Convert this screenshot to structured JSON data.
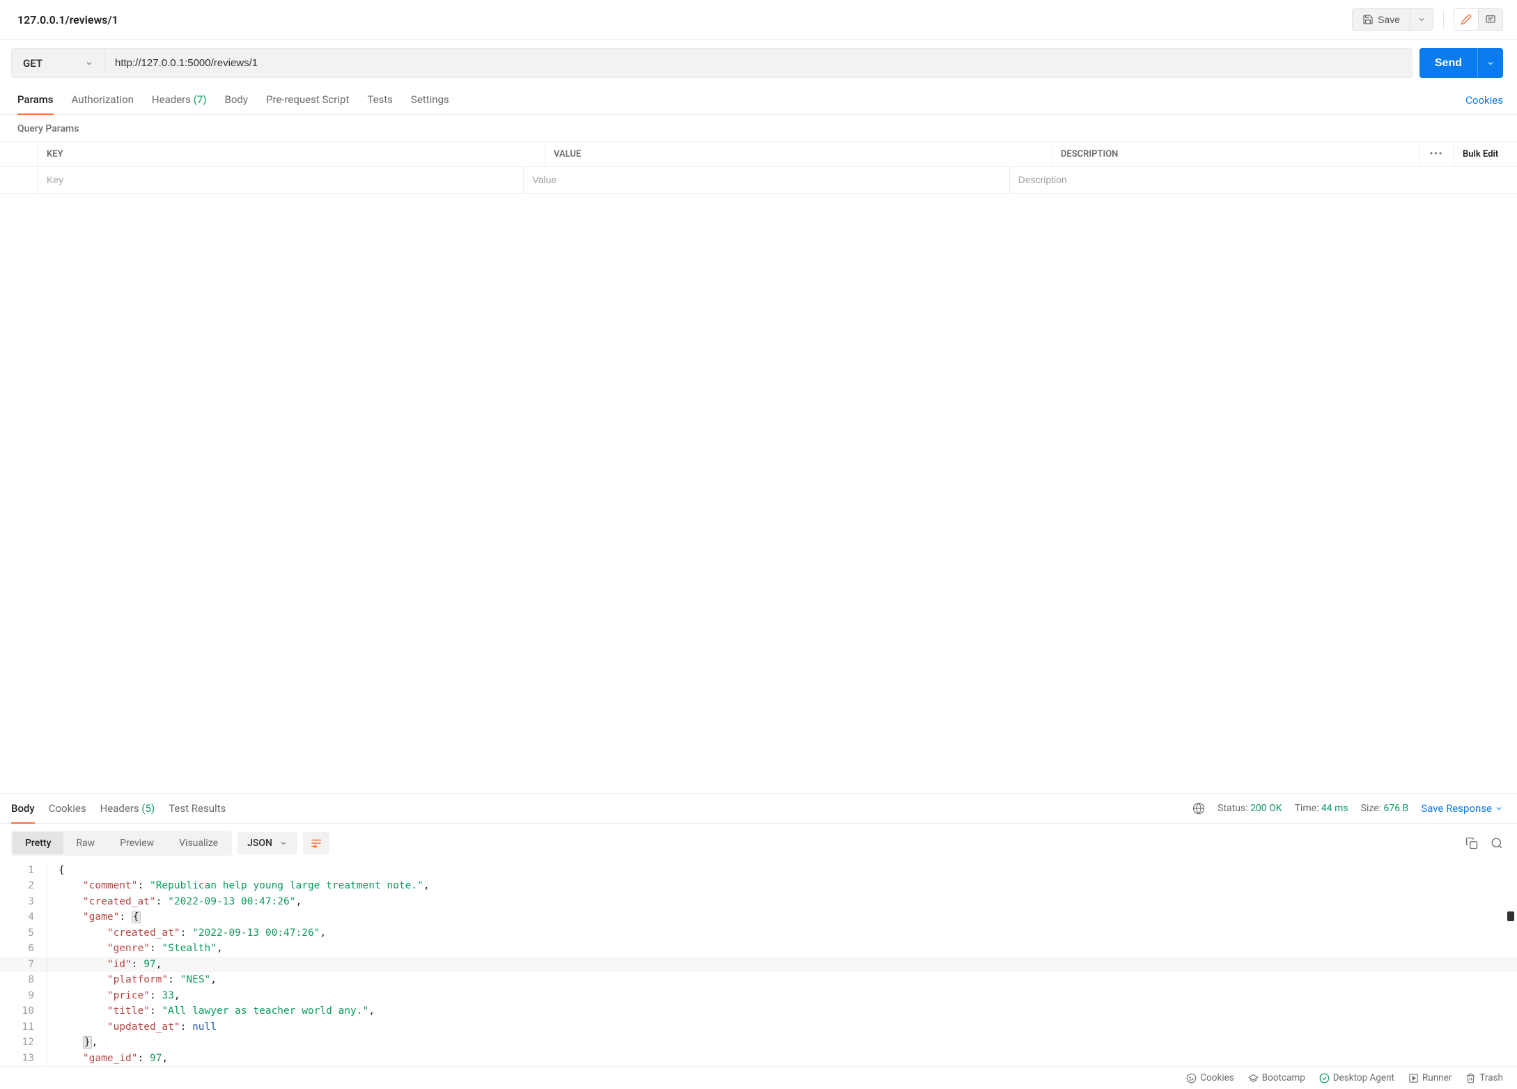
{
  "header": {
    "request_name": "127.0.0.1/reviews/1",
    "save_label": "Save"
  },
  "request": {
    "method": "GET",
    "url": "http://127.0.0.1:5000/reviews/1",
    "send_label": "Send"
  },
  "req_tabs": {
    "params": "Params",
    "authorization": "Authorization",
    "headers": "Headers",
    "headers_count": "(7)",
    "body": "Body",
    "pre_request": "Pre-request Script",
    "tests": "Tests",
    "settings": "Settings",
    "cookies_link": "Cookies"
  },
  "params_section": {
    "title": "Query Params",
    "col_key": "KEY",
    "col_value": "VALUE",
    "col_desc": "DESCRIPTION",
    "bulk_edit": "Bulk Edit",
    "ph_key": "Key",
    "ph_value": "Value",
    "ph_desc": "Description"
  },
  "resp_tabs": {
    "body": "Body",
    "cookies": "Cookies",
    "headers": "Headers",
    "headers_count": "(5)",
    "test_results": "Test Results"
  },
  "resp_meta": {
    "status_label": "Status:",
    "status_value": "200 OK",
    "time_label": "Time:",
    "time_value": "44 ms",
    "size_label": "Size:",
    "size_value": "676 B",
    "save_response": "Save Response"
  },
  "resp_toolbar": {
    "pretty": "Pretty",
    "raw": "Raw",
    "preview": "Preview",
    "visualize": "Visualize",
    "format": "JSON"
  },
  "code_lines": [
    {
      "n": 1,
      "html": "<span class=\"tok-brace\">{</span>"
    },
    {
      "n": 2,
      "html": "    <span class=\"tok-key\">\"comment\"</span><span class=\"tok-punct\">: </span><span class=\"tok-str\">\"Republican help young large treatment note.\"</span><span class=\"tok-punct\">,</span>"
    },
    {
      "n": 3,
      "html": "    <span class=\"tok-key\">\"created_at\"</span><span class=\"tok-punct\">: </span><span class=\"tok-str\">\"2022-09-13 00:47:26\"</span><span class=\"tok-punct\">,</span>"
    },
    {
      "n": 4,
      "html": "    <span class=\"tok-key\">\"game\"</span><span class=\"tok-punct\">: </span><span class=\"fold-box tok-brace\">{</span>"
    },
    {
      "n": 5,
      "html": "        <span class=\"tok-key\">\"created_at\"</span><span class=\"tok-punct\">: </span><span class=\"tok-str\">\"2022-09-13 00:47:26\"</span><span class=\"tok-punct\">,</span>"
    },
    {
      "n": 6,
      "html": "        <span class=\"tok-key\">\"genre\"</span><span class=\"tok-punct\">: </span><span class=\"tok-str\">\"Stealth\"</span><span class=\"tok-punct\">,</span>"
    },
    {
      "n": 7,
      "html": "        <span class=\"tok-key\">\"id\"</span><span class=\"tok-punct\">: </span><span class=\"tok-num\">97</span><span class=\"tok-punct\">,</span>",
      "hl": true
    },
    {
      "n": 8,
      "html": "        <span class=\"tok-key\">\"platform\"</span><span class=\"tok-punct\">: </span><span class=\"tok-str\">\"NES\"</span><span class=\"tok-punct\">,</span>"
    },
    {
      "n": 9,
      "html": "        <span class=\"tok-key\">\"price\"</span><span class=\"tok-punct\">: </span><span class=\"tok-num\">33</span><span class=\"tok-punct\">,</span>"
    },
    {
      "n": 10,
      "html": "        <span class=\"tok-key\">\"title\"</span><span class=\"tok-punct\">: </span><span class=\"tok-str\">\"All lawyer as teacher world any.\"</span><span class=\"tok-punct\">,</span>"
    },
    {
      "n": 11,
      "html": "        <span class=\"tok-key\">\"updated_at\"</span><span class=\"tok-punct\">: </span><span class=\"tok-null\">null</span>"
    },
    {
      "n": 12,
      "html": "    <span class=\"fold-box tok-brace\">}</span><span class=\"tok-punct\">,</span>"
    },
    {
      "n": 13,
      "html": "    <span class=\"tok-key\">\"game_id\"</span><span class=\"tok-punct\">: </span><span class=\"tok-num\">97</span><span class=\"tok-punct\">,</span>"
    }
  ],
  "footer": {
    "cookies": "Cookies",
    "bootcamp": "Bootcamp",
    "desktop_agent": "Desktop Agent",
    "runner": "Runner",
    "trash": "Trash"
  }
}
